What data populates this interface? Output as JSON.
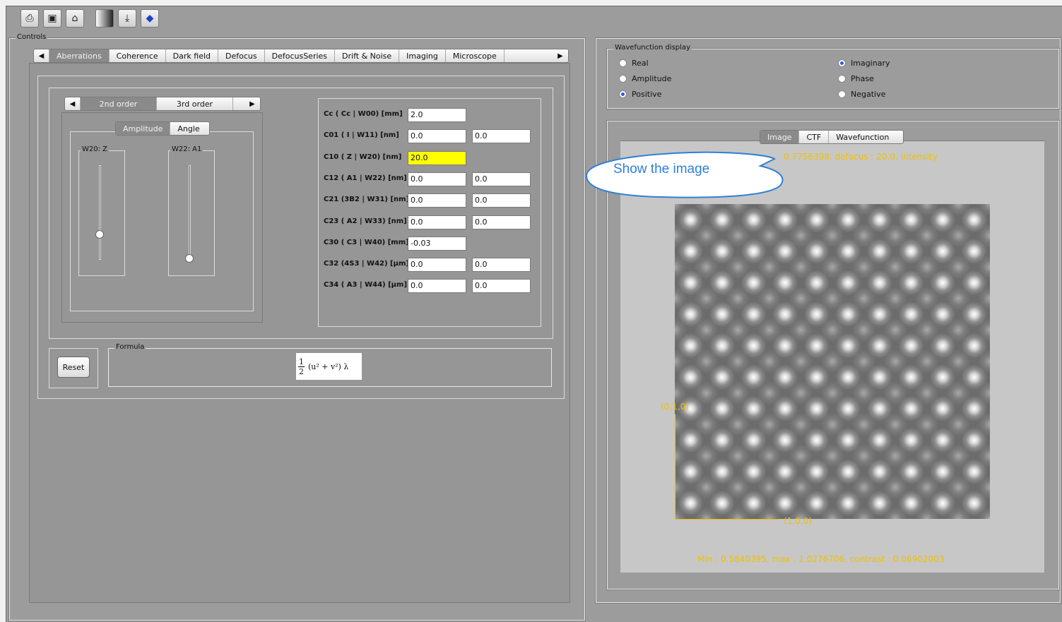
{
  "toolbar": {
    "icons": [
      "printer-icon",
      "save-icon",
      "folder-open-icon",
      "gradient-icon",
      "export-icon",
      "book-icon"
    ]
  },
  "controls": {
    "label": "Controls",
    "tabs": [
      "Aberrations",
      "Coherence",
      "Dark field",
      "Defocus",
      "DefocusSeries",
      "Drift & Noise",
      "Imaging",
      "Microscope"
    ],
    "active_tab": "Aberrations",
    "order_tabs": [
      "2nd order",
      "3rd order"
    ],
    "mode_tabs": [
      "Amplitude",
      "Angle"
    ],
    "slider1_label": "W20: Z",
    "slider2_label": "W22: A1",
    "slider1_level": 0.7,
    "slider2_level": 0.95,
    "params": [
      {
        "label": "Cc ( Cc | W00) [mm]",
        "v1": "2.0",
        "v2": null
      },
      {
        "label": "C01 ( I | W11) [nm]",
        "v1": "0.0",
        "v2": "0.0"
      },
      {
        "label": "C10 ( Z | W20) [nm]",
        "v1": "20.0",
        "v2": null
      },
      {
        "label": "C12 ( A1 | W22) [nm]",
        "v1": "0.0",
        "v2": "0.0"
      },
      {
        "label": "C21 (3B2 | W31) [nm]",
        "v1": "0.0",
        "v2": "0.0"
      },
      {
        "label": "C23 ( A2 | W33) [nm]",
        "v1": "0.0",
        "v2": "0.0"
      },
      {
        "label": "C30 ( C3 | W40) [mm]",
        "v1": "-0.03",
        "v2": null
      },
      {
        "label": "C32 (4S3 | W42) [µm]",
        "v1": "0.0",
        "v2": "0.0"
      },
      {
        "label": "C34 ( A3 | W44) [µm]",
        "v1": "0.0",
        "v2": "0.0"
      }
    ],
    "reset": "Reset",
    "formula_label": "Formula",
    "formula": {
      "num": "1",
      "den": "2",
      "body": "(u² + v²) λ"
    }
  },
  "wavefunction": {
    "label": "Wavefunction display",
    "options": [
      {
        "label": "Real",
        "checked": false
      },
      {
        "label": "Imaginary",
        "checked": true
      },
      {
        "label": "Amplitude",
        "checked": false
      },
      {
        "label": "Phase",
        "checked": false
      },
      {
        "label": "Positive",
        "checked": true
      },
      {
        "label": "Negative",
        "checked": false
      }
    ]
  },
  "view": {
    "tabs": [
      "Image",
      "CTF",
      "Wavefunction"
    ],
    "active_tab": "Image",
    "header_text": "0.7756398, defocus : 20.0, Intensity",
    "callout": "Show the image",
    "axis_y": "(0,1,0)",
    "axis_x": "(1,0,0)",
    "footer_text": "Min : 0.5840395, max : 1.0276706, contrast : 0.06902003"
  },
  "colors": {
    "annotation": "#f0c000",
    "highlight": "#ffff00",
    "callout": "#2f7fd6"
  }
}
